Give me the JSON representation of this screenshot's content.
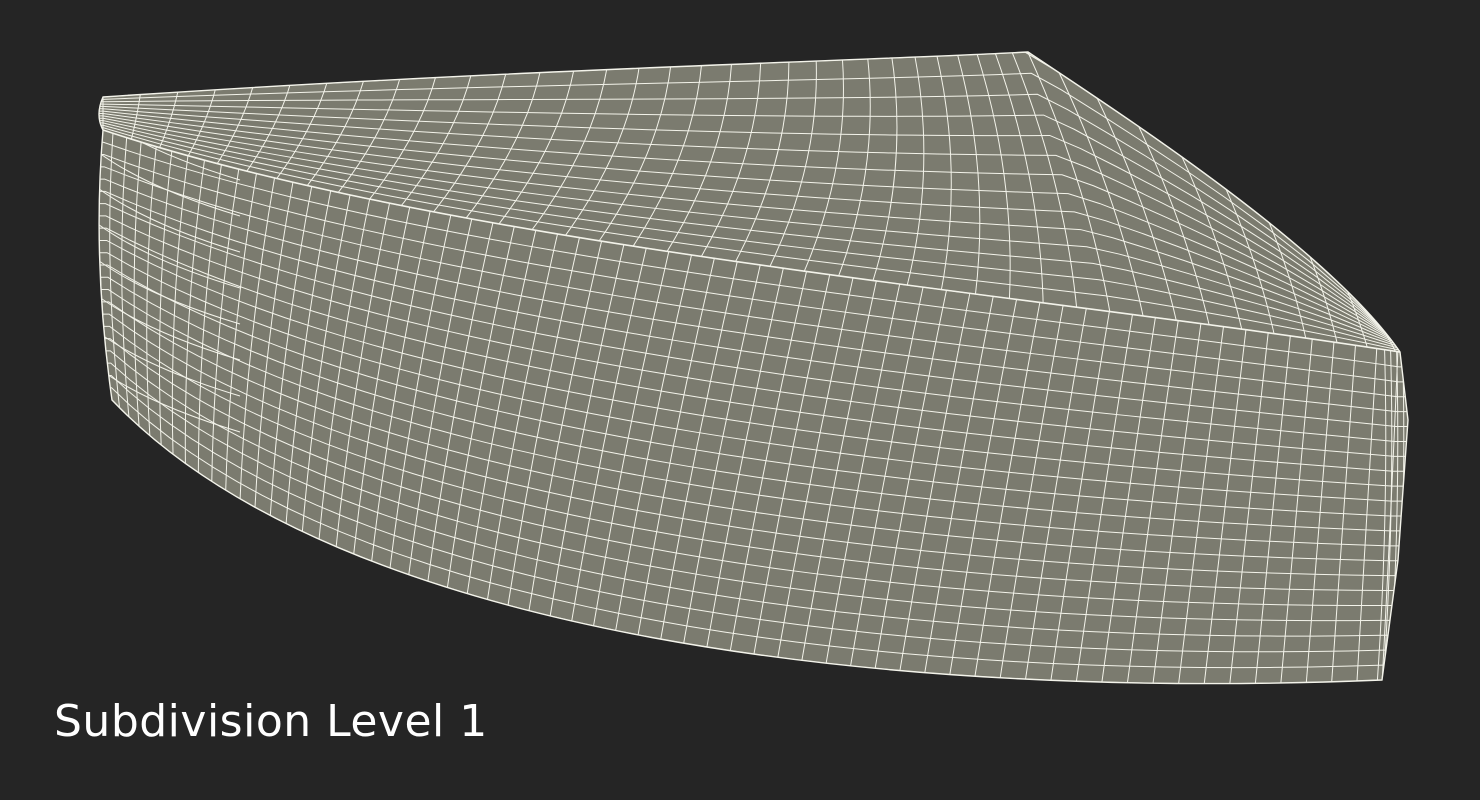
{
  "caption": "Subdivision Level 1",
  "colors": {
    "background": "#252525",
    "mesh_fill": "#7b7b6f",
    "wire": "#f3f3ea",
    "caption": "#ffffff"
  },
  "icons": {
    "model": "wireframe-mesh-icon"
  }
}
